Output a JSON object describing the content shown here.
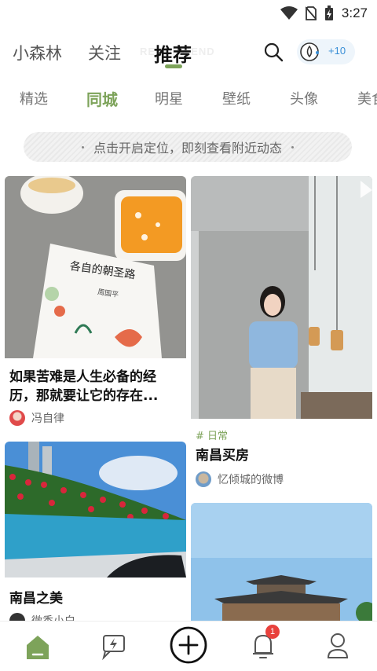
{
  "status_bar": {
    "time": "3:27",
    "icons": [
      "wifi-icon",
      "no-sim-icon",
      "battery-charging-icon"
    ]
  },
  "top_nav": {
    "tabs": [
      {
        "label": "小森林",
        "active": false
      },
      {
        "label": "关注",
        "active": false
      },
      {
        "label": "推荐",
        "active": true
      }
    ],
    "ghost_text": "RECOMMEND",
    "points_badge": "+10",
    "accent_color": "#7da35a"
  },
  "categories": [
    {
      "label": "精选",
      "active": false
    },
    {
      "label": "同城",
      "active": true
    },
    {
      "label": "明星",
      "active": false
    },
    {
      "label": "壁纸",
      "active": false
    },
    {
      "label": "头像",
      "active": false
    },
    {
      "label": "美食",
      "active": false
    }
  ],
  "location_banner": {
    "text": "点击开启定位，即刻查看附近动态"
  },
  "feed": {
    "left": [
      {
        "title": "如果苦难是人生必备的经历，那就要让它的存在...",
        "author": "冯自律",
        "image_text": {
          "book_title": "各自的朝圣路",
          "book_author": "周国平"
        }
      },
      {
        "title": "南昌之美",
        "author": "微香小白"
      }
    ],
    "right": [
      {
        "tag": "# 日常",
        "title": "南昌买房",
        "author": "忆倾城的微博"
      },
      {
        "title": ""
      }
    ]
  },
  "bottom_nav": {
    "items": [
      "home-icon",
      "flash-chat-icon",
      "publish-icon",
      "notification-icon",
      "profile-icon"
    ],
    "notification_count": "1"
  }
}
